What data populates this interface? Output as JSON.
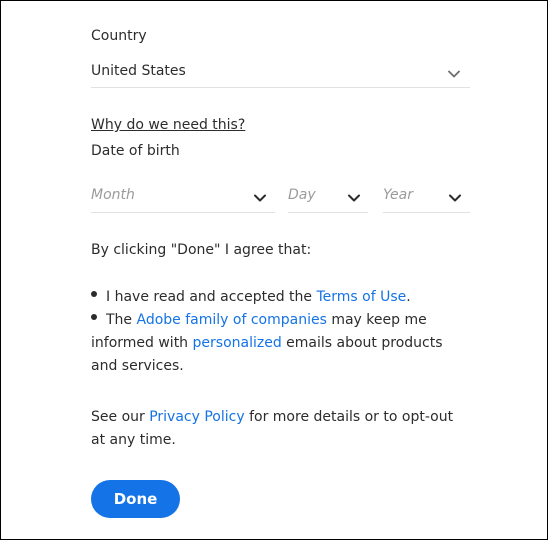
{
  "country": {
    "label": "Country",
    "selected": "United States"
  },
  "why_link": "Why do we need this?",
  "dob": {
    "label": "Date of birth",
    "month_placeholder": "Month",
    "day_placeholder": "Day",
    "year_placeholder": "Year"
  },
  "agree_text": "By clicking \"Done\" I agree that:",
  "bullet1": {
    "prefix": "I have read and accepted the ",
    "link": "Terms of Use",
    "suffix": "."
  },
  "bullet2": {
    "prefix": "The ",
    "link1": "Adobe family of companies",
    "middle": " may keep me informed with ",
    "link2": "personalized",
    "suffix": " emails about products and services."
  },
  "privacy": {
    "prefix": "See our ",
    "link": "Privacy Policy",
    "suffix": " for more details or to opt-out at any time."
  },
  "done_label": "Done",
  "icons": {
    "chevron": "chevron-down-icon",
    "bullet": "bullet-icon"
  },
  "colors": {
    "link": "#1473e6",
    "button": "#1473e6",
    "text": "#2c2c2c",
    "placeholder": "#9b9b9b"
  }
}
